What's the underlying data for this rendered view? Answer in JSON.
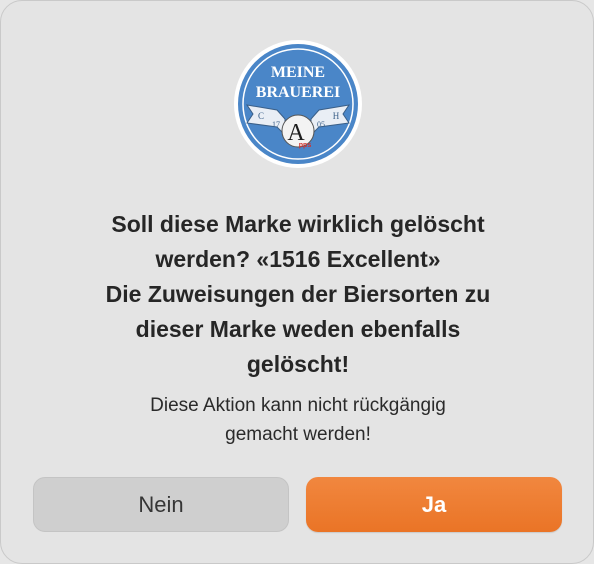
{
  "dialog": {
    "logo": {
      "line1": "MEINE",
      "line2": "BRAUEREI",
      "ribbon_left": "C",
      "ribbon_num_left": "17",
      "ribbon_num_right": "05",
      "ribbon_right": "H",
      "emblem_letter": "A",
      "emblem_sub": "pps",
      "icon": "brewery-logo-icon",
      "colors": {
        "ring": "#ffffff",
        "disc": "#4a86c8",
        "ribbon": "#e9eef5",
        "accent": "#d0312d"
      }
    },
    "title": "Soll diese Marke wirklich gelöscht\nwerden? «1516 Excellent»\nDie Zuweisungen der Biersorten zu\ndieser Marke weden ebenfalls\ngelöscht!",
    "message": "Diese Aktion kann nicht rückgängig\ngemacht werden!",
    "buttons": {
      "no_label": "Nein",
      "yes_label": "Ja"
    },
    "colors": {
      "primary_button": "#ee7a2f",
      "secondary_button": "#cfcfcf",
      "background": "#e4e4e4"
    }
  }
}
